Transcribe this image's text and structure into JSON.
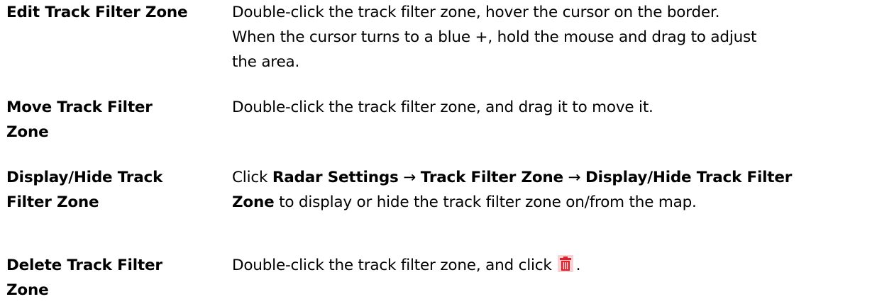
{
  "rows": [
    {
      "term": [
        "Edit Track Filter Zone"
      ],
      "description_lines": [
        "Double-click the track filter zone, hover the cursor on the border.",
        "When the cursor turns to a blue +, hold the mouse and drag to adjust",
        "the area."
      ]
    },
    {
      "term": [
        "Move Track Filter",
        "Zone"
      ],
      "description_lines": [
        "Double-click the track filter zone, and drag it to move it."
      ]
    },
    {
      "term": [
        "Display/Hide Track",
        "Filter Zone"
      ],
      "description": {
        "click": "Click",
        "radar_settings": "Radar Settings",
        "arrow": "→",
        "track_filter_zone": "Track Filter Zone",
        "display_hide_1": "Display/Hide Track Filter",
        "display_hide_2": "Zone",
        "tail": "to display or hide the track filter zone on/from the map."
      }
    },
    {
      "term": [
        "Delete Track Filter",
        "Zone"
      ],
      "description": {
        "text": "Double-click the track filter zone, and click",
        "end_punct": ".",
        "icon": "trash-icon",
        "icon_color": "#e0202a"
      }
    }
  ]
}
